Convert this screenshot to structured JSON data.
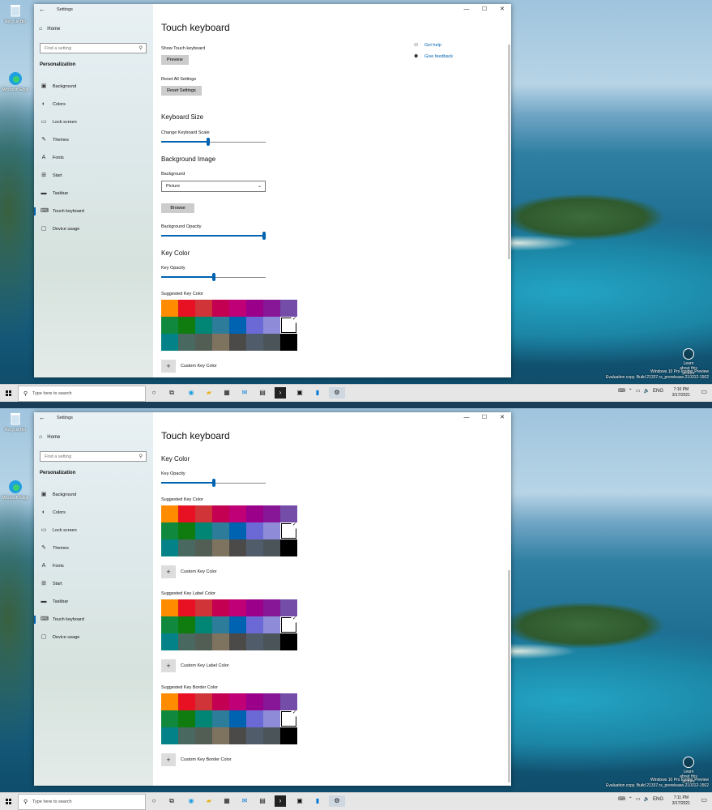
{
  "colors": {
    "accent": "#0063b1"
  },
  "desktop": {
    "icons": [
      {
        "label": "Recycle Bin",
        "icon": "recycle-bin-icon"
      },
      {
        "label": "Microsoft Edge",
        "icon": "edge-icon"
      }
    ],
    "watermark": [
      "Windows 10 Pro Insider Preview",
      "Evaluation copy. Build 21337.rs_prerelease.210312-1502"
    ],
    "notification_label": "Learn about this picture"
  },
  "window": {
    "title": "Settings",
    "sidebar": {
      "home": "Home",
      "search_placeholder": "Find a setting",
      "section": "Personalization",
      "items": [
        {
          "label": "Background",
          "icon": "picture-icon"
        },
        {
          "label": "Colors",
          "icon": "palette-icon"
        },
        {
          "label": "Lock screen",
          "icon": "lock-screen-icon"
        },
        {
          "label": "Themes",
          "icon": "brush-icon"
        },
        {
          "label": "Fonts",
          "icon": "font-icon"
        },
        {
          "label": "Start",
          "icon": "start-icon"
        },
        {
          "label": "Taskbar",
          "icon": "taskbar-icon"
        },
        {
          "label": "Touch keyboard",
          "icon": "keyboard-icon"
        },
        {
          "label": "Device usage",
          "icon": "device-icon"
        }
      ],
      "active_index": 7
    },
    "page_title": "Touch keyboard",
    "help": {
      "get_help": "Get help",
      "give_feedback": "Give feedback"
    },
    "top": {
      "show_touch_keyboard": "Show Touch keyboard",
      "preview_button": "Preview",
      "reset_all": "Reset All Settings",
      "reset_button": "Reset Settings",
      "keyboard_size": "Keyboard Size",
      "change_scale": "Change Keyboard Scale",
      "scale_level": 0.45,
      "background_image": "Background Image",
      "background_label": "Background",
      "background_value": "Picture",
      "browse_button": "Browse",
      "background_opacity": "Background Opacity",
      "opacity_level": 1.0,
      "key_color": "Key Color",
      "key_opacity": "Key Opacity",
      "key_opacity_level": 0.5,
      "suggested_key_color": "Suggested Key Color",
      "custom_key_color": "Custom Key Color"
    },
    "bottom": {
      "key_color": "Key Color",
      "key_opacity": "Key Opacity",
      "key_opacity_level": 0.5,
      "suggested_key_color": "Suggested Key Color",
      "custom_key_color": "Custom Key Color",
      "suggested_label_color": "Suggested Key Label Color",
      "custom_label_color": "Custom Key Label Color",
      "suggested_border_color": "Suggested Key Border Color",
      "custom_border_color": "Custom Key Border Color"
    },
    "palette": [
      "#ff8c00",
      "#e81123",
      "#d13438",
      "#c30052",
      "#bf0077",
      "#9a0089",
      "#881798",
      "#744da9",
      "#10893e",
      "#107c10",
      "#018574",
      "#2d7d9a",
      "#0063b1",
      "#6b69d6",
      "#8e8cd8",
      "#ffffff",
      "#038387",
      "#486860",
      "#525e54",
      "#7e735f",
      "#4c4a48",
      "#515c6b",
      "#4a5459",
      "#000000"
    ],
    "selected_swatch": 15
  },
  "taskbar": {
    "search_placeholder": "Type here to search",
    "icons": [
      "task-view-icon",
      "edge-icon",
      "file-explorer-icon",
      "store-icon",
      "mail-icon",
      "photos-icon",
      "terminal-icon",
      "app-icon",
      "notepad-icon",
      "settings-icon"
    ],
    "shot1": {
      "time": "7:10 PM",
      "date": "3/17/2021"
    },
    "shot2": {
      "time": "7:11 PM",
      "date": "3/17/2021"
    }
  }
}
